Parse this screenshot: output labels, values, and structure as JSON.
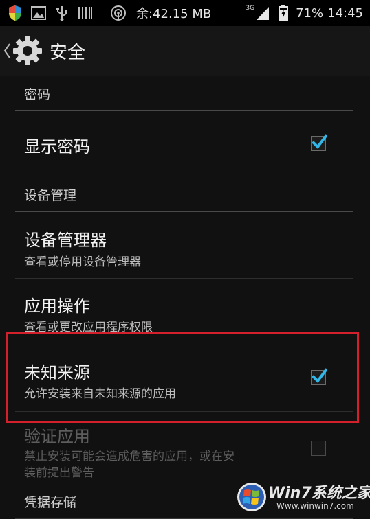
{
  "status_bar": {
    "memory": "余:42.15 MB",
    "network": "3G",
    "battery": "71%",
    "time": "14:45"
  },
  "action_bar": {
    "title": "安全"
  },
  "sections": {
    "password": "密码",
    "device_admin": "设备管理",
    "credential_storage": "凭据存储"
  },
  "items": {
    "show_password": {
      "title": "显示密码",
      "checked": true
    },
    "device_administrators": {
      "title": "设备管理器",
      "summary": "查看或停用设备管理器"
    },
    "app_ops": {
      "title": "应用操作",
      "summary": "查看或更改应用程序权限"
    },
    "unknown_sources": {
      "title": "未知来源",
      "summary": "允许安装来自未知来源的应用",
      "checked": true
    },
    "verify_apps": {
      "title": "验证应用",
      "summary_line1": "禁止安装可能会造成危害的应用，或在安",
      "summary_line2": "装前提出警告",
      "checked": false,
      "enabled": false
    }
  },
  "watermark": {
    "brand": "Win7系统之家",
    "url": "Www.winwin7.com"
  },
  "colors": {
    "accent": "#33b5e5",
    "highlight": "#d3202a"
  }
}
